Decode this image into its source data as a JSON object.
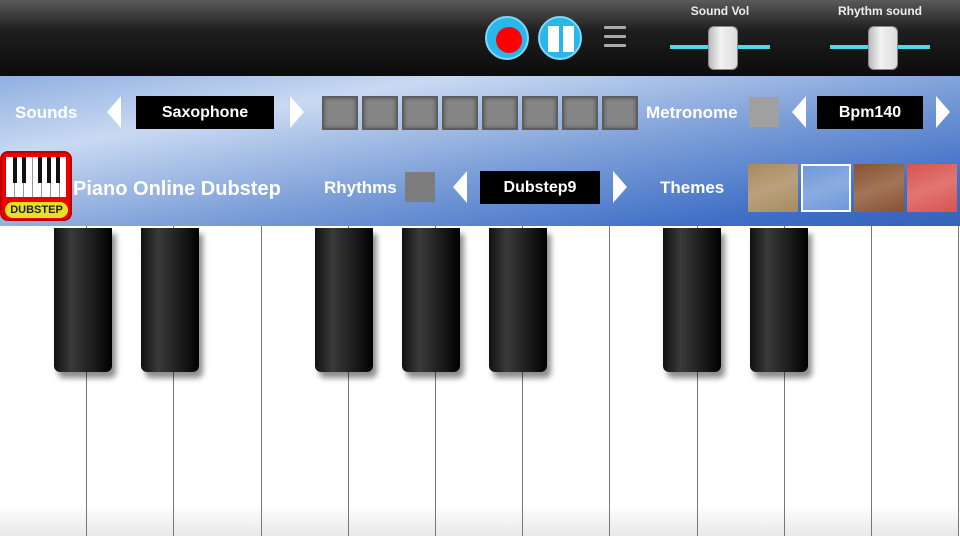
{
  "toolbar": {
    "record_icon": "record-icon",
    "pause_icon": "pause-icon",
    "menu_icon": "hamburger-menu-icon",
    "sound_vol": {
      "label": "Sound Vol",
      "value_percent": 50
    },
    "rhythm_sound": {
      "label": "Rhythm sound",
      "value_percent": 50
    }
  },
  "sounds": {
    "label": "Sounds",
    "value": "Saxophone"
  },
  "steps": {
    "count": 8
  },
  "metronome": {
    "label": "Metronome",
    "value": "Bpm140",
    "enabled": false
  },
  "app": {
    "title": "Piano Online Dubstep",
    "logo_text": "DUBSTEP"
  },
  "rhythms": {
    "label": "Rhythms",
    "value": "Dubstep9",
    "enabled": false
  },
  "themes": {
    "label": "Themes",
    "swatches": [
      "#a88a5e",
      "#6e97da",
      "#8a5230",
      "#d9534f"
    ],
    "selected_index": 1
  },
  "colors": {
    "accent": "#29b6ea",
    "record": "#ff0000",
    "slider": "#4fd8f0"
  }
}
